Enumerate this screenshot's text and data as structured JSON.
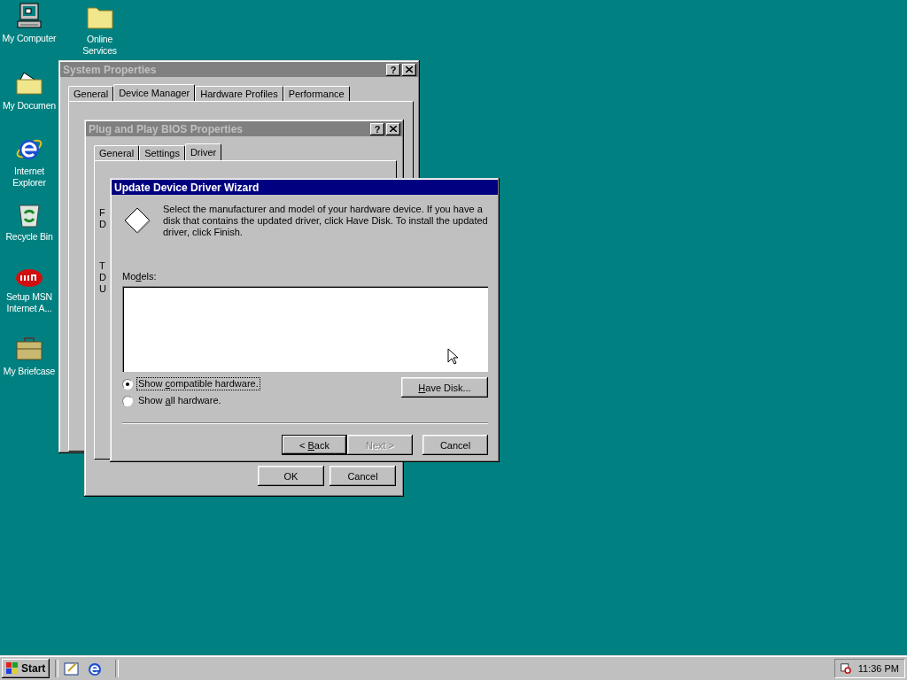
{
  "desktop_icons": [
    {
      "label": "My Computer",
      "kind": "computer"
    },
    {
      "label": "Online Services",
      "kind": "folder"
    },
    {
      "label": "My Documen",
      "kind": "documents"
    },
    {
      "label": "Internet Explorer",
      "kind": "browser"
    },
    {
      "label": "Recycle Bin",
      "kind": "recycle"
    },
    {
      "label": "Setup MSN Internet A...",
      "kind": "msn"
    },
    {
      "label": "My Briefcase",
      "kind": "briefcase"
    }
  ],
  "system_properties": {
    "title": "System Properties",
    "active": false,
    "help": "?",
    "tabs": [
      {
        "label": "General",
        "selected": false
      },
      {
        "label": "Device Manager",
        "selected": true
      },
      {
        "label": "Hardware Profiles",
        "selected": false
      },
      {
        "label": "Performance",
        "selected": false
      }
    ]
  },
  "bios_properties": {
    "title": "Plug and Play BIOS Properties",
    "active": false,
    "help": "?",
    "tabs": [
      {
        "label": "General",
        "selected": false
      },
      {
        "label": "Settings",
        "selected": false
      },
      {
        "label": "Driver",
        "selected": true
      }
    ],
    "peeking_letters": [
      "F",
      "D",
      "T",
      "D",
      "U"
    ],
    "buttons": [
      {
        "label": "OK"
      },
      {
        "label": "Cancel"
      }
    ]
  },
  "wizard": {
    "title": "Update Device Driver Wizard",
    "active": true,
    "description": "Select the manufacturer and model of your hardware device. If you have a disk that contains the updated driver, click Have Disk. To install the updated driver, click Finish.",
    "models_label": {
      "before": "Mo",
      "hotkey": "d",
      "after": "els:"
    },
    "radios": [
      {
        "before": "Show ",
        "hotkey": "c",
        "after": "ompatible hardware.",
        "selected": true,
        "focused": true
      },
      {
        "before": "Show ",
        "hotkey": "a",
        "after": "ll hardware.",
        "selected": false,
        "focused": false
      }
    ],
    "have_disk": {
      "hotkey": "H",
      "after": "ave Disk..."
    },
    "buttons": [
      {
        "before": "< ",
        "hotkey": "B",
        "after": "ack",
        "disabled": false,
        "default": true
      },
      {
        "before": "Next >",
        "disabled": true,
        "default": false
      },
      {
        "before": "Cancel",
        "disabled": false,
        "default": false
      }
    ]
  },
  "taskbar": {
    "start": "Start",
    "clock": "11:36 PM"
  }
}
